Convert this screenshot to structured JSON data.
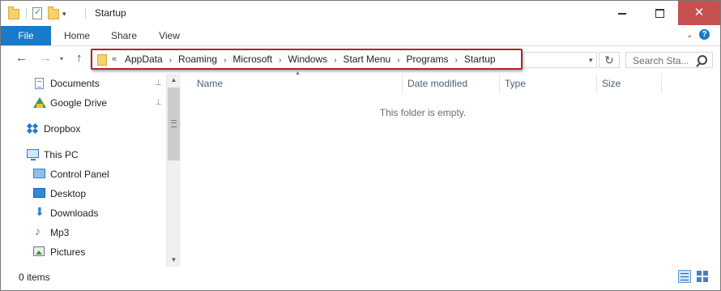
{
  "window": {
    "title": "Startup",
    "controls": {
      "minimize": "minimize",
      "maximize": "maximize",
      "close": "✕"
    }
  },
  "quick_access": {
    "icons": [
      "folder-icon",
      "properties-icon",
      "new-folder-icon",
      "chevron-down-icon"
    ]
  },
  "ribbon": {
    "tabs": [
      {
        "label": "File",
        "active": true
      },
      {
        "label": "Home"
      },
      {
        "label": "Share"
      },
      {
        "label": "View"
      }
    ],
    "expand_icon": "chevron-down-icon",
    "help_label": "?"
  },
  "navigation": {
    "back_icon": "←",
    "forward_icon": "→",
    "recent_icon": "⌄",
    "up_icon": "↑",
    "address": {
      "overflow": "«",
      "breadcrumbs": [
        "AppData",
        "Roaming",
        "Microsoft",
        "Windows",
        "Start Menu",
        "Programs",
        "Startup"
      ],
      "separator": "›",
      "highlight_color": "#b0262d"
    },
    "refresh_icon": "↻",
    "search_placeholder": "Search Sta..."
  },
  "nav_pane": {
    "items": [
      {
        "label": "Documents",
        "icon": "documents-icon",
        "pinned": true
      },
      {
        "label": "Google Drive",
        "icon": "google-drive-icon",
        "pinned": true
      },
      {
        "label": "Dropbox",
        "icon": "dropbox-icon"
      },
      {
        "label": "This PC",
        "icon": "computer-icon"
      },
      {
        "label": "Control Panel",
        "icon": "control-panel-icon"
      },
      {
        "label": "Desktop",
        "icon": "desktop-icon"
      },
      {
        "label": "Downloads",
        "icon": "downloads-icon"
      },
      {
        "label": "Mp3",
        "icon": "music-icon"
      },
      {
        "label": "Pictures",
        "icon": "pictures-icon"
      }
    ],
    "pin_glyph": "📌"
  },
  "content": {
    "columns": [
      "Name",
      "Date modified",
      "Type",
      "Size"
    ],
    "sort_glyph": "▲",
    "empty_message": "This folder is empty."
  },
  "status_bar": {
    "item_count": "0 items"
  },
  "colors": {
    "accent": "#1979ca",
    "close_hover": "#c75050",
    "address_highlight": "#b0262d"
  }
}
